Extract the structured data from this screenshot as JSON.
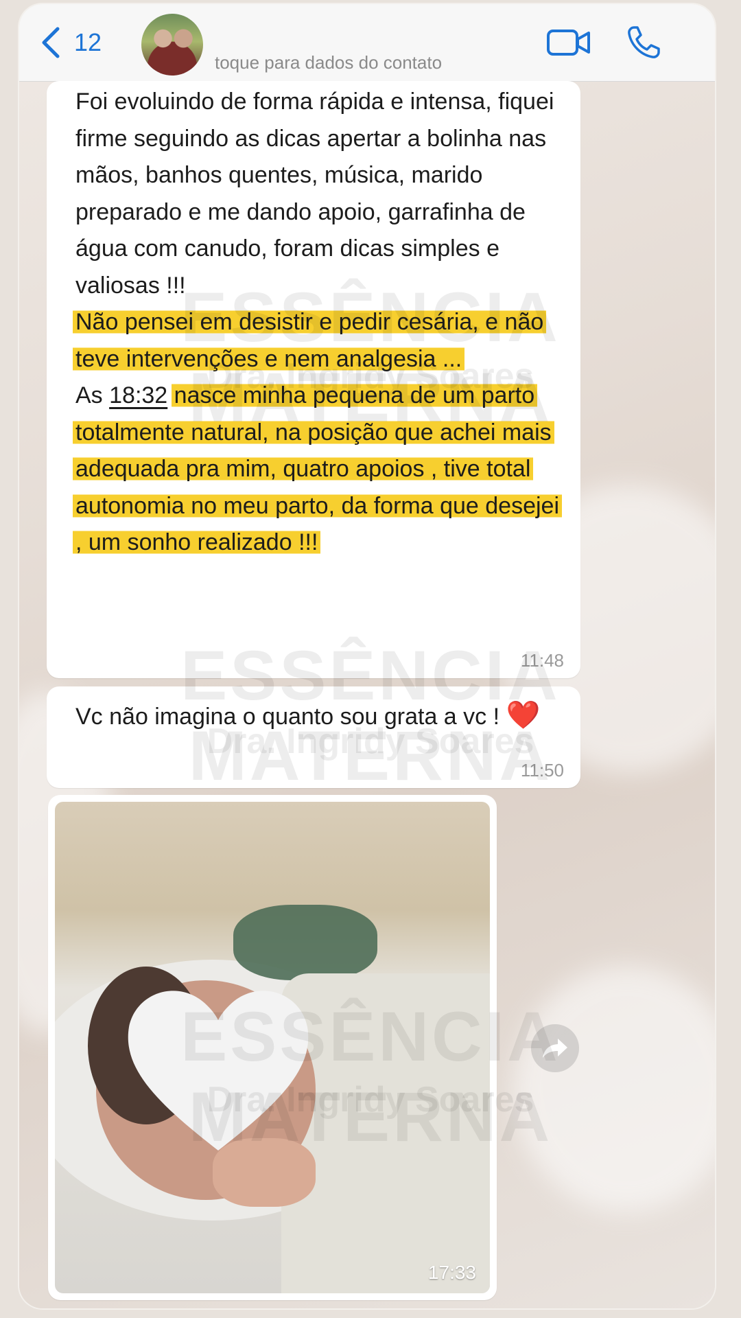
{
  "header": {
    "back_count": "12",
    "contact_subtitle": "toque para dados do contato",
    "icons": {
      "back": "chevron-left-icon",
      "video": "video-call-icon",
      "call": "phone-icon"
    }
  },
  "messages": [
    {
      "segments": {
        "plain1": " Foi evoluindo de forma rápida e intensa,  fiquei firme seguindo as dicas apertar a bolinha nas mãos, banhos quentes,  música, marido preparado e me dando apoio, garrafinha de água com canudo, foram dicas simples e valiosas !!!",
        "highlight1": "Não pensei em desistir e pedir cesária, e não teve intervenções e nem analgesia ...",
        "plain2": "As ",
        "underlined_time": "18:32",
        "highlight2": "nasce minha pequena de um parto totalmente natural, na posição que achei mais adequada pra mim, quatro apoios , tive total autonomia no meu parto, da forma que desejei , um sonho realizado !!!"
      },
      "time": "11:48"
    },
    {
      "text": "Vc não imagina o quanto sou grata a vc ! ",
      "emoji": "❤️",
      "time": "11:50"
    },
    {
      "type": "photo",
      "time": "17:33"
    }
  ],
  "watermark": {
    "title": "ESSÊNCIA MATERNA",
    "subtitle": "Dra. Ingridy Soares"
  },
  "colors": {
    "highlight": "#f7cf2f",
    "link_blue": "#1d74d6",
    "bubble": "#ffffff"
  }
}
